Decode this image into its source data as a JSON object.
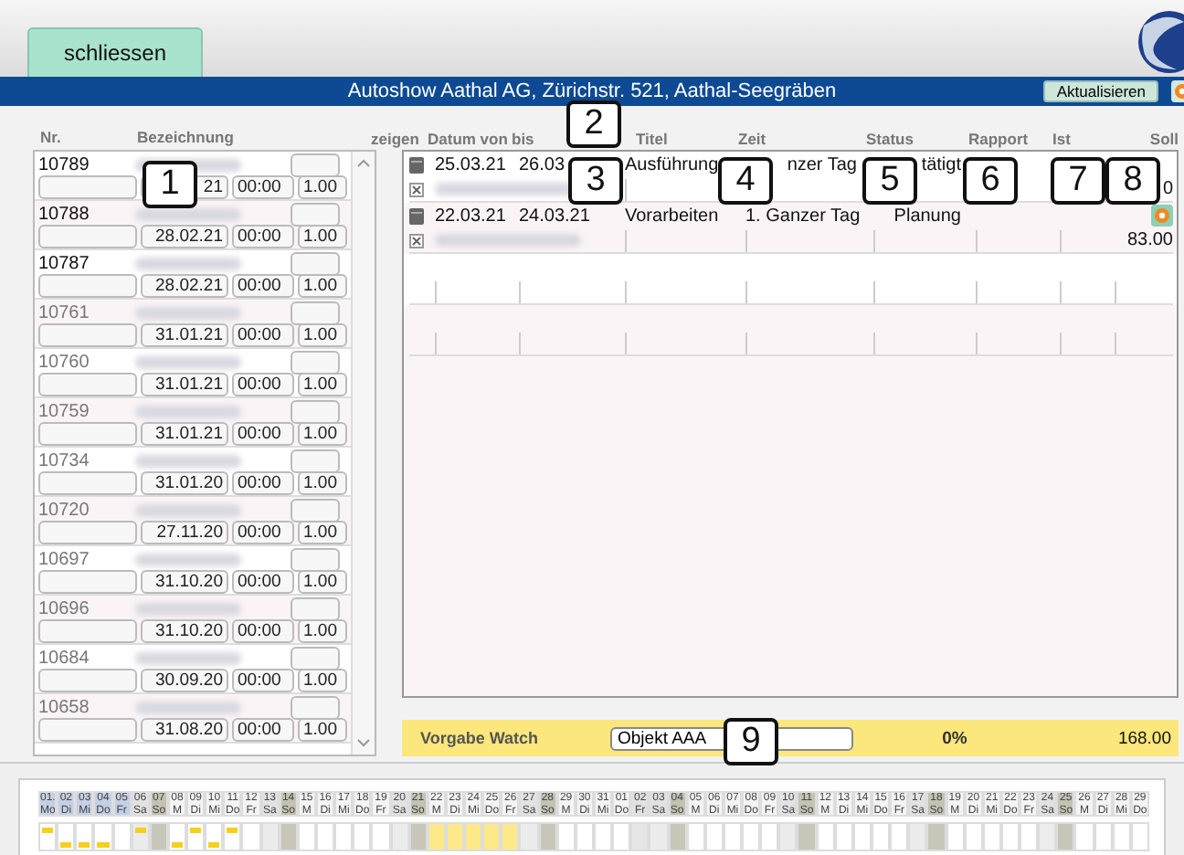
{
  "tab": {
    "label": "schliessen",
    "selected": true
  },
  "title": "Autoshow Aathal AG, Zürichstr. 521, Aathal-Seegräben",
  "refresh_button": "Aktualisieren",
  "list": {
    "columns": [
      "Nr.",
      "Bezeichnung"
    ],
    "rows": [
      {
        "nr": "10789",
        "active": true,
        "date": "21",
        "time": "00:00",
        "amount": "1.00"
      },
      {
        "nr": "10788",
        "active": true,
        "date": "28.02.21",
        "time": "00:00",
        "amount": "1.00"
      },
      {
        "nr": "10787",
        "active": true,
        "date": "28.02.21",
        "time": "00:00",
        "amount": "1.00"
      },
      {
        "nr": "10761",
        "active": false,
        "date": "31.01.21",
        "time": "00:00",
        "amount": "1.00"
      },
      {
        "nr": "10760",
        "active": false,
        "date": "31.01.21",
        "time": "00:00",
        "amount": "1.00"
      },
      {
        "nr": "10759",
        "active": false,
        "date": "31.01.21",
        "time": "00:00",
        "amount": "1.00"
      },
      {
        "nr": "10734",
        "active": false,
        "date": "31.01.20",
        "time": "00:00",
        "amount": "1.00"
      },
      {
        "nr": "10720",
        "active": false,
        "date": "27.11.20",
        "time": "00:00",
        "amount": "1.00"
      },
      {
        "nr": "10697",
        "active": false,
        "date": "31.10.20",
        "time": "00:00",
        "amount": "1.00"
      },
      {
        "nr": "10696",
        "active": false,
        "date": "31.10.20",
        "time": "00:00",
        "amount": "1.00"
      },
      {
        "nr": "10684",
        "active": false,
        "date": "30.09.20",
        "time": "00:00",
        "amount": "1.00"
      },
      {
        "nr": "10658",
        "active": false,
        "date": "31.08.20",
        "time": "00:00",
        "amount": "1.00"
      }
    ]
  },
  "table": {
    "columns": [
      "zeigen",
      "Datum von",
      "bis",
      "Titel",
      "Zeit",
      "Status",
      "Rapport",
      "Ist",
      "Soll"
    ],
    "rows": [
      {
        "from": "25.03.21",
        "to": "26.03",
        "title": "Ausführung",
        "time": "nzer Tag",
        "status": "tätigt",
        "button": false,
        "soll": "0"
      },
      {
        "from": "22.03.21",
        "to": "24.03.21",
        "title": "Vorarbeiten",
        "time": "1. Ganzer Tag",
        "status": "Planung",
        "button": true,
        "soll": "83.00"
      }
    ]
  },
  "watch": {
    "label": "Vorgabe Watch",
    "object": "Objekt AAA",
    "percent": "0%",
    "total": "168.00"
  },
  "callouts": [
    "1",
    "2",
    "3",
    "4",
    "5",
    "6",
    "7",
    "8",
    "9"
  ],
  "calendar": [
    {
      "d": "01.",
      "w": "Mo",
      "kind": "weekday",
      "selected": true,
      "booked": false,
      "top_bar": true,
      "bottom_bar": false
    },
    {
      "d": "02",
      "w": "Di",
      "kind": "weekday",
      "selected": true,
      "booked": false,
      "top_bar": false,
      "bottom_bar": true
    },
    {
      "d": "03",
      "w": "Mi",
      "kind": "weekday",
      "selected": true,
      "booked": false,
      "top_bar": false,
      "bottom_bar": true
    },
    {
      "d": "04",
      "w": "Do",
      "kind": "weekday",
      "selected": true,
      "booked": false,
      "top_bar": false,
      "bottom_bar": true
    },
    {
      "d": "05",
      "w": "Fr",
      "kind": "weekday",
      "selected": true,
      "booked": false,
      "top_bar": false,
      "bottom_bar": false
    },
    {
      "d": "06",
      "w": "Sa",
      "kind": "saturday",
      "selected": false,
      "booked": false,
      "top_bar": true,
      "bottom_bar": false
    },
    {
      "d": "07",
      "w": "So",
      "kind": "sunday",
      "selected": false,
      "booked": false,
      "top_bar": false,
      "bottom_bar": false
    },
    {
      "d": "08",
      "w": "M",
      "kind": "weekday",
      "selected": false,
      "booked": false,
      "top_bar": false,
      "bottom_bar": true
    },
    {
      "d": "09",
      "w": "Di",
      "kind": "weekday",
      "selected": false,
      "booked": false,
      "top_bar": true,
      "bottom_bar": false
    },
    {
      "d": "10",
      "w": "Mi",
      "kind": "weekday",
      "selected": false,
      "booked": false,
      "top_bar": false,
      "bottom_bar": true
    },
    {
      "d": "11",
      "w": "Do",
      "kind": "weekday",
      "selected": false,
      "booked": false,
      "top_bar": true,
      "bottom_bar": false
    },
    {
      "d": "12",
      "w": "Fr",
      "kind": "weekday",
      "selected": false,
      "booked": false,
      "top_bar": false,
      "bottom_bar": false
    },
    {
      "d": "13",
      "w": "Sa",
      "kind": "saturday",
      "selected": false,
      "booked": false,
      "top_bar": false,
      "bottom_bar": false
    },
    {
      "d": "14",
      "w": "So",
      "kind": "sunday",
      "selected": false,
      "booked": false,
      "top_bar": false,
      "bottom_bar": false
    },
    {
      "d": "15",
      "w": "M",
      "kind": "weekday",
      "selected": false,
      "booked": false,
      "top_bar": false,
      "bottom_bar": false
    },
    {
      "d": "16",
      "w": "Di",
      "kind": "weekday",
      "selected": false,
      "booked": false,
      "top_bar": false,
      "bottom_bar": false
    },
    {
      "d": "17",
      "w": "Mi",
      "kind": "weekday",
      "selected": false,
      "booked": false,
      "top_bar": false,
      "bottom_bar": false
    },
    {
      "d": "18",
      "w": "Do",
      "kind": "weekday",
      "selected": false,
      "booked": false,
      "top_bar": false,
      "bottom_bar": false
    },
    {
      "d": "19",
      "w": "Fr",
      "kind": "weekday",
      "selected": false,
      "booked": false,
      "top_bar": false,
      "bottom_bar": false
    },
    {
      "d": "20",
      "w": "Sa",
      "kind": "saturday",
      "selected": false,
      "booked": false,
      "top_bar": false,
      "bottom_bar": false
    },
    {
      "d": "21",
      "w": "So",
      "kind": "sunday",
      "selected": false,
      "booked": false,
      "top_bar": false,
      "bottom_bar": false
    },
    {
      "d": "22",
      "w": "M",
      "kind": "weekday",
      "selected": false,
      "booked": true,
      "top_bar": false,
      "bottom_bar": false
    },
    {
      "d": "23",
      "w": "Di",
      "kind": "weekday",
      "selected": false,
      "booked": true,
      "top_bar": false,
      "bottom_bar": false
    },
    {
      "d": "24",
      "w": "Mi",
      "kind": "weekday",
      "selected": false,
      "booked": true,
      "top_bar": false,
      "bottom_bar": false
    },
    {
      "d": "25",
      "w": "Do",
      "kind": "weekday",
      "selected": false,
      "booked": true,
      "top_bar": false,
      "bottom_bar": false
    },
    {
      "d": "26",
      "w": "Fr",
      "kind": "weekday",
      "selected": false,
      "booked": true,
      "top_bar": false,
      "bottom_bar": false
    },
    {
      "d": "27",
      "w": "Sa",
      "kind": "saturday",
      "selected": false,
      "booked": false,
      "top_bar": false,
      "bottom_bar": false
    },
    {
      "d": "28",
      "w": "So",
      "kind": "sunday",
      "selected": false,
      "booked": false,
      "top_bar": false,
      "bottom_bar": false
    },
    {
      "d": "29",
      "w": "M",
      "kind": "weekday",
      "selected": false,
      "booked": false,
      "top_bar": false,
      "bottom_bar": false
    },
    {
      "d": "30",
      "w": "Di",
      "kind": "weekday",
      "selected": false,
      "booked": false,
      "top_bar": false,
      "bottom_bar": false
    },
    {
      "d": "31",
      "w": "Mi",
      "kind": "weekday",
      "selected": false,
      "booked": false,
      "top_bar": false,
      "bottom_bar": false
    },
    {
      "d": "01",
      "w": "Do",
      "kind": "weekday",
      "selected": false,
      "booked": false,
      "top_bar": false,
      "bottom_bar": false
    },
    {
      "d": "02",
      "w": "Fr",
      "kind": "holiday",
      "selected": false,
      "booked": false,
      "top_bar": false,
      "bottom_bar": false
    },
    {
      "d": "03",
      "w": "Sa",
      "kind": "saturday",
      "selected": false,
      "booked": false,
      "top_bar": false,
      "bottom_bar": false
    },
    {
      "d": "04",
      "w": "So",
      "kind": "sunday",
      "selected": false,
      "booked": false,
      "top_bar": false,
      "bottom_bar": false
    },
    {
      "d": "05",
      "w": "M",
      "kind": "weekday",
      "selected": false,
      "booked": false,
      "top_bar": false,
      "bottom_bar": false
    },
    {
      "d": "06",
      "w": "Di",
      "kind": "weekday",
      "selected": false,
      "booked": false,
      "top_bar": false,
      "bottom_bar": false
    },
    {
      "d": "07",
      "w": "Mi",
      "kind": "weekday",
      "selected": false,
      "booked": false,
      "top_bar": false,
      "bottom_bar": false
    },
    {
      "d": "08",
      "w": "Do",
      "kind": "weekday",
      "selected": false,
      "booked": false,
      "top_bar": false,
      "bottom_bar": false
    },
    {
      "d": "09",
      "w": "Fr",
      "kind": "weekday",
      "selected": false,
      "booked": false,
      "top_bar": false,
      "bottom_bar": false
    },
    {
      "d": "10",
      "w": "Sa",
      "kind": "saturday",
      "selected": false,
      "booked": false,
      "top_bar": false,
      "bottom_bar": false
    },
    {
      "d": "11",
      "w": "So",
      "kind": "sunday",
      "selected": false,
      "booked": false,
      "top_bar": false,
      "bottom_bar": false
    },
    {
      "d": "12",
      "w": "M",
      "kind": "weekday",
      "selected": false,
      "booked": false,
      "top_bar": false,
      "bottom_bar": false
    },
    {
      "d": "13",
      "w": "Di",
      "kind": "weekday",
      "selected": false,
      "booked": false,
      "top_bar": false,
      "bottom_bar": false
    },
    {
      "d": "14",
      "w": "Mi",
      "kind": "weekday",
      "selected": false,
      "booked": false,
      "top_bar": false,
      "bottom_bar": false
    },
    {
      "d": "15",
      "w": "Do",
      "kind": "weekday",
      "selected": false,
      "booked": false,
      "top_bar": false,
      "bottom_bar": false
    },
    {
      "d": "16",
      "w": "Fr",
      "kind": "weekday",
      "selected": false,
      "booked": false,
      "top_bar": false,
      "bottom_bar": false
    },
    {
      "d": "17",
      "w": "Sa",
      "kind": "saturday",
      "selected": false,
      "booked": false,
      "top_bar": false,
      "bottom_bar": false
    },
    {
      "d": "18",
      "w": "So",
      "kind": "sunday",
      "selected": false,
      "booked": false,
      "top_bar": false,
      "bottom_bar": false
    },
    {
      "d": "19",
      "w": "M",
      "kind": "weekday",
      "selected": false,
      "booked": false,
      "top_bar": false,
      "bottom_bar": false
    },
    {
      "d": "20",
      "w": "Di",
      "kind": "weekday",
      "selected": false,
      "booked": false,
      "top_bar": false,
      "bottom_bar": false
    },
    {
      "d": "21",
      "w": "Mi",
      "kind": "weekday",
      "selected": false,
      "booked": false,
      "top_bar": false,
      "bottom_bar": false
    },
    {
      "d": "22",
      "w": "Do",
      "kind": "weekday",
      "selected": false,
      "booked": false,
      "top_bar": false,
      "bottom_bar": false
    },
    {
      "d": "23",
      "w": "Fr",
      "kind": "weekday",
      "selected": false,
      "booked": false,
      "top_bar": false,
      "bottom_bar": false
    },
    {
      "d": "24",
      "w": "Sa",
      "kind": "saturday",
      "selected": false,
      "booked": false,
      "top_bar": false,
      "bottom_bar": false
    },
    {
      "d": "25",
      "w": "So",
      "kind": "sunday",
      "selected": false,
      "booked": false,
      "top_bar": false,
      "bottom_bar": false
    },
    {
      "d": "26",
      "w": "M",
      "kind": "weekday",
      "selected": false,
      "booked": false,
      "top_bar": false,
      "bottom_bar": false
    },
    {
      "d": "27",
      "w": "Di",
      "kind": "weekday",
      "selected": false,
      "booked": false,
      "top_bar": false,
      "bottom_bar": false
    },
    {
      "d": "28",
      "w": "Mi",
      "kind": "weekday",
      "selected": false,
      "booked": false,
      "top_bar": false,
      "bottom_bar": false
    },
    {
      "d": "29",
      "w": "Do",
      "kind": "weekday",
      "selected": false,
      "booked": false,
      "top_bar": false,
      "bottom_bar": false
    }
  ]
}
